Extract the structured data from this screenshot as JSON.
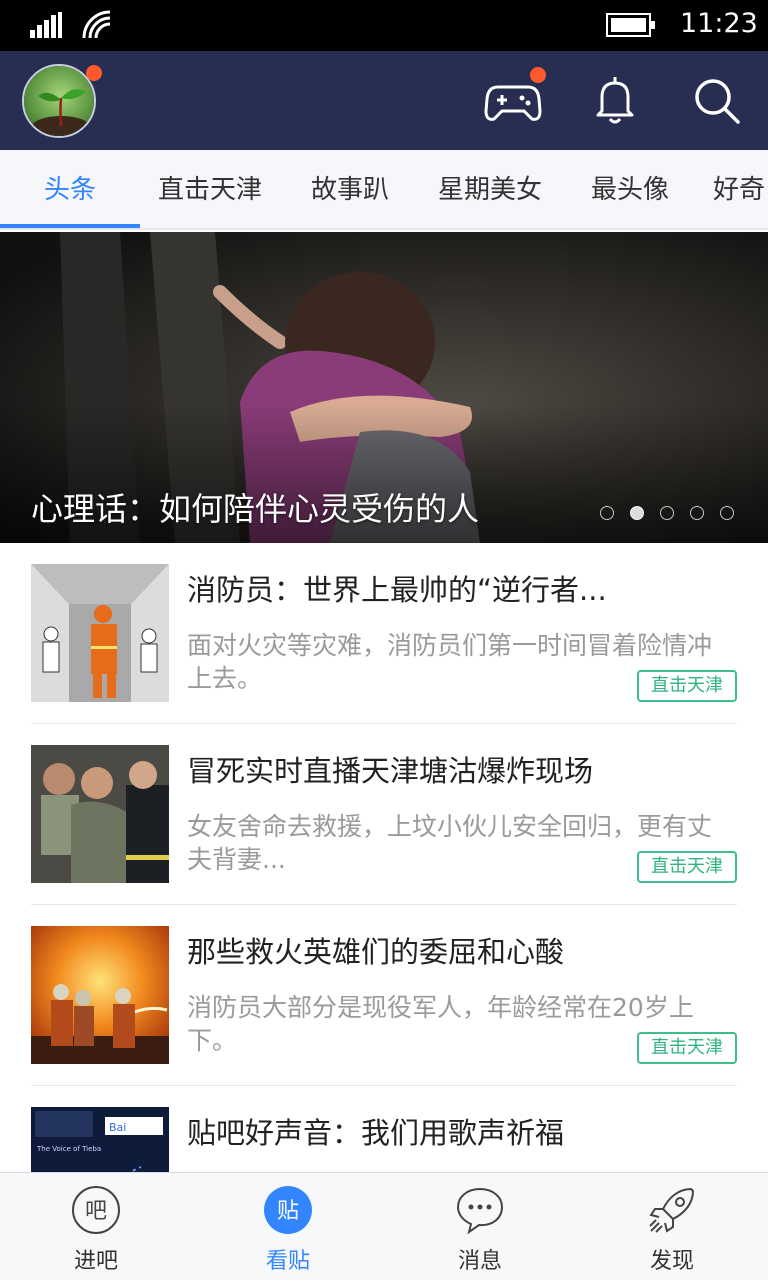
{
  "status_bar": {
    "time": "11:23"
  },
  "header": {
    "avatar_icon": "sprout-avatar",
    "actions": [
      "gamepad-icon",
      "bell-icon",
      "search-icon"
    ],
    "badge_color": "#ff5a2c",
    "bg_color": "#282d52"
  },
  "tabs": [
    {
      "label": "头条",
      "active": true
    },
    {
      "label": "直击天津"
    },
    {
      "label": "故事趴"
    },
    {
      "label": "星期美女"
    },
    {
      "label": "最头像"
    },
    {
      "label": "好奇"
    }
  ],
  "banner": {
    "caption": "心理话：如何陪伴心灵受伤的人",
    "slide_count": 5,
    "active_slide": 2
  },
  "feed": [
    {
      "title": "消防员：世界上最帅的“逆行者...",
      "desc": "面对火灾等灾难，消防员们第一时间冒着险情冲上去。",
      "tag": "直击天津"
    },
    {
      "title": "冒死实时直播天津塘沽爆炸现场",
      "desc": "女友舍命去救援，上坟小伙儿安全回归，更有丈夫背妻...",
      "tag": "直击天津"
    },
    {
      "title": "那些救火英雄们的委屈和心酸",
      "desc": "消防员大部分是现役军人，年龄经常在20岁上下。",
      "tag": "直击天津"
    },
    {
      "title": "贴吧好声音：我们用歌声祈福",
      "thumb_text_1": "Bai",
      "thumb_text_2": "The Voice of Tieba"
    }
  ],
  "bottom_nav": [
    {
      "label": "进吧",
      "icon_text": "吧"
    },
    {
      "label": "看贴",
      "icon_text": "贴",
      "active": true
    },
    {
      "label": "消息"
    },
    {
      "label": "发现"
    }
  ],
  "colors": {
    "accent": "#3385ff",
    "tag_green": "#3cbf8b"
  }
}
